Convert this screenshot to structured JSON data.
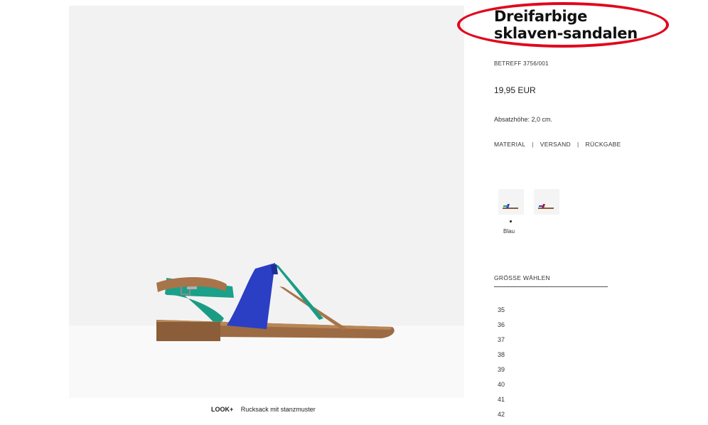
{
  "product": {
    "title": "Dreifarbige sklaven-sandalen",
    "reference": "BETREFF 3756/001",
    "price": "19,95 EUR",
    "heel_height": "Absatzhöhe: 2,0 cm."
  },
  "info_links": {
    "material": "MATERIAL",
    "shipping": "VERSAND",
    "returns": "RÜCKGABE",
    "separator": "|"
  },
  "colors": {
    "selected_label": "Blau",
    "swatches": [
      "blue-sandal-swatch",
      "red-sandal-swatch"
    ]
  },
  "sizes": {
    "heading": "GRÖSSE WÄHLEN",
    "options": [
      "35",
      "36",
      "37",
      "38",
      "39",
      "40",
      "41",
      "42"
    ]
  },
  "look": {
    "label": "LOOK+",
    "item": "Rucksack mit stanzmuster"
  },
  "colors_palette": {
    "highlight_circle": "#e1061c",
    "strap_blue": "#2b3fc4",
    "strap_teal": "#1a9c84",
    "leather": "#a8744a"
  }
}
